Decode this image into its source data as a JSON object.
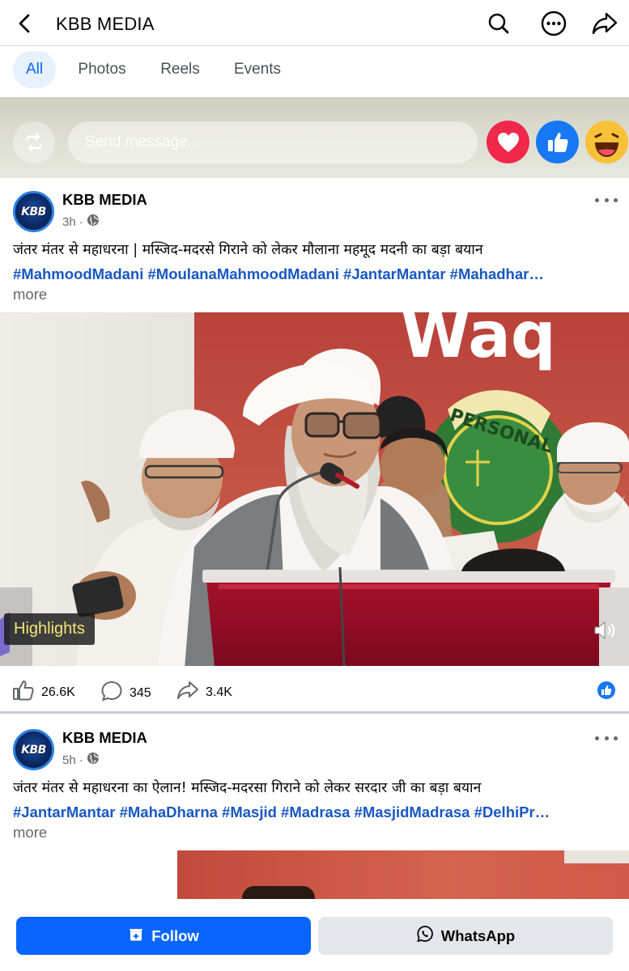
{
  "header": {
    "title": "KBB MEDIA",
    "icons": [
      "back-arrow-icon",
      "search-icon",
      "more-options-icon",
      "share-icon"
    ]
  },
  "tabs": [
    {
      "label": "All",
      "active": true
    },
    {
      "label": "Photos",
      "active": false
    },
    {
      "label": "Reels",
      "active": false
    },
    {
      "label": "Events",
      "active": false
    }
  ],
  "message_bar": {
    "placeholder": "Send message...",
    "reactions": [
      "heart-icon",
      "like-icon",
      "laugh-emoji-icon"
    ]
  },
  "posts": [
    {
      "author": "KBB MEDIA",
      "avatar_text": "KBB",
      "time": "3h",
      "visibility": "globe-icon",
      "caption": "जंतर मंतर से महाधरना | मस्जिद-मदरसे गिराने को लेकर मौलाना महमूद मदनी का बड़ा बयान",
      "hashtags": "#MahmoodMadani #MoulanaMahmoodMadani #JantarMantar #Mahadhar…",
      "more": "more",
      "video_badge": "Highlights",
      "banner_text": "Waq",
      "emblem_text": "PERSONAL",
      "likes": "26.6K",
      "comments": "345",
      "shares": "3.4K"
    },
    {
      "author": "KBB MEDIA",
      "avatar_text": "KBB",
      "time": "5h",
      "visibility": "globe-icon",
      "caption": "जंतर मंतर से महाधरना का ऐलान! मस्जिद-मदरसा गिराने को लेकर सरदार जी का बड़ा बयान",
      "hashtags": "#JantarMantar #MahaDharna #Masjid #Madrasa #MasjidMadrasa #DelhiPr…",
      "more": "more"
    }
  ],
  "bottom_actions": {
    "follow_label": "Follow",
    "whatsapp_label": "WhatsApp"
  },
  "colors": {
    "accent": "#0866ff",
    "hashtag": "#1857c4",
    "heart": "#f0284a",
    "like": "#1877f2"
  }
}
